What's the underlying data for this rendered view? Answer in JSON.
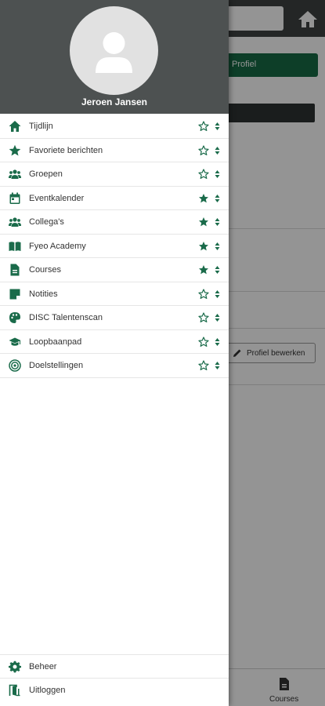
{
  "colors": {
    "accent": "#1a6b4a",
    "header": "#4d5151",
    "topbar": "#3f4242"
  },
  "user": {
    "name": "Jeroen Jansen"
  },
  "menu": [
    {
      "label": "Tijdlijn",
      "icon": "home-icon",
      "favorite": false
    },
    {
      "label": "Favoriete berichten",
      "icon": "star-icon",
      "favorite": false
    },
    {
      "label": "Groepen",
      "icon": "users-icon",
      "favorite": false
    },
    {
      "label": "Eventkalender",
      "icon": "calendar-icon",
      "favorite": true
    },
    {
      "label": "Collega's",
      "icon": "users-icon",
      "favorite": true
    },
    {
      "label": "Fyeo Academy",
      "icon": "book-icon",
      "favorite": true
    },
    {
      "label": "Courses",
      "icon": "document-icon",
      "favorite": true
    },
    {
      "label": "Notities",
      "icon": "note-icon",
      "favorite": false
    },
    {
      "label": "DISC Talentenscan",
      "icon": "palette-icon",
      "favorite": false
    },
    {
      "label": "Loopbaanpad",
      "icon": "graduation-cap-icon",
      "favorite": false
    },
    {
      "label": "Doelstellingen",
      "icon": "target-icon",
      "favorite": false
    }
  ],
  "footer": [
    {
      "label": "Beheer",
      "icon": "gear-icon"
    },
    {
      "label": "Uitloggen",
      "icon": "logout-icon"
    }
  ],
  "background": {
    "profile_button": "Profiel",
    "edit_button": "Profiel bewerken",
    "bottom_nav_label": "Courses"
  }
}
